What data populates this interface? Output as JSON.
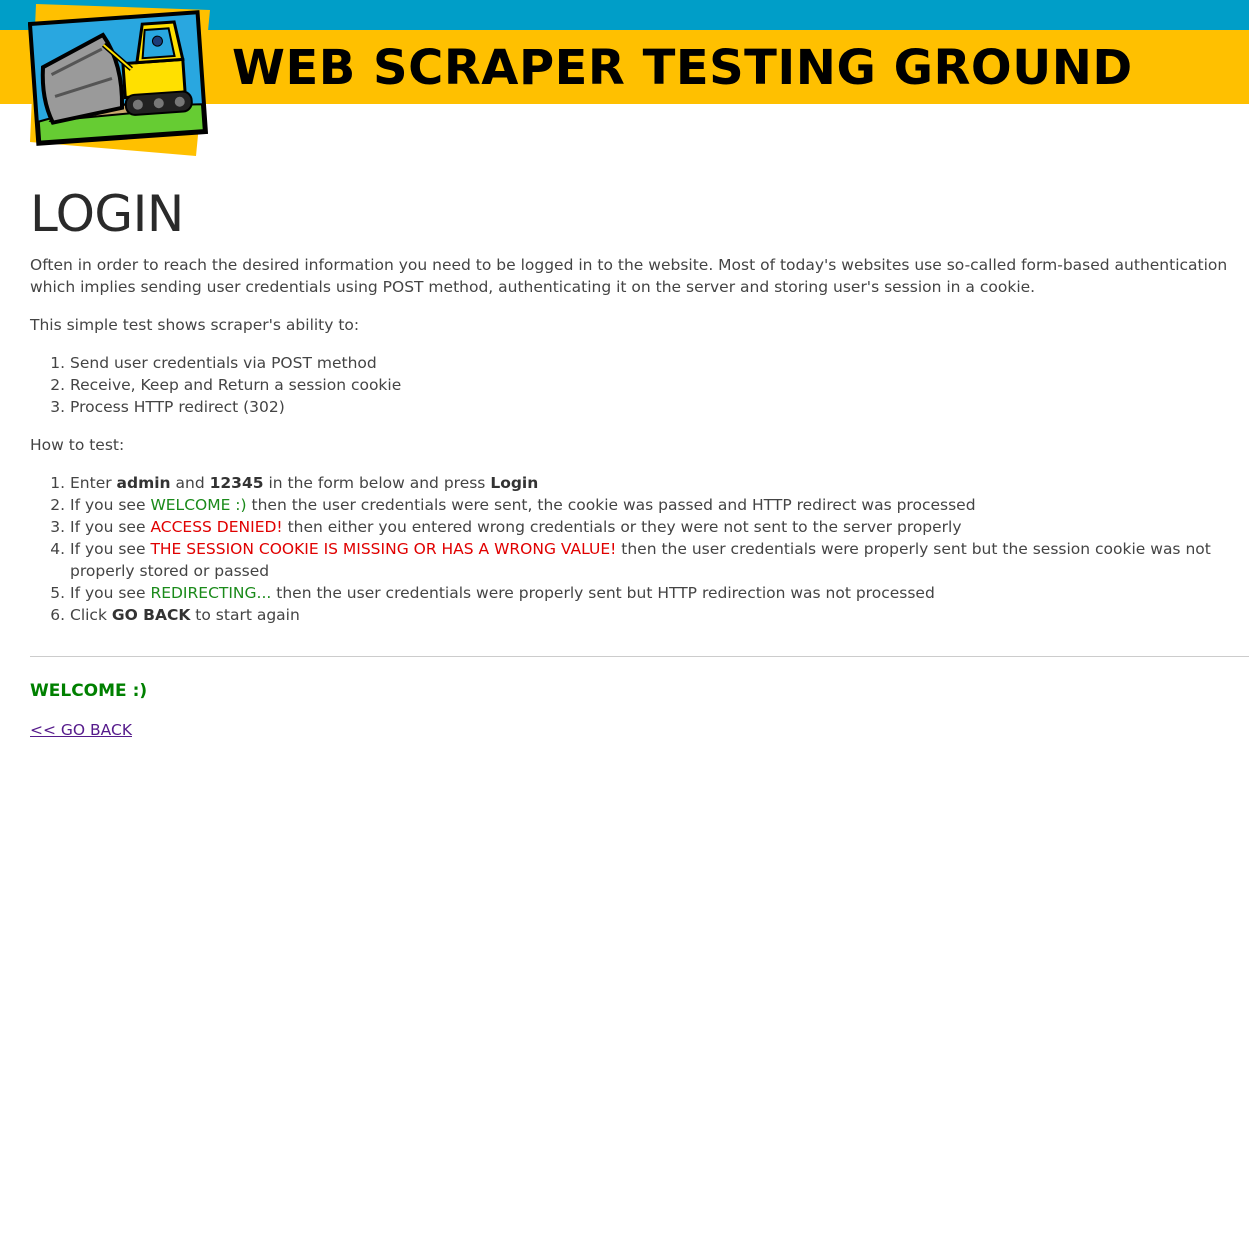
{
  "header": {
    "site_title": "WEB SCRAPER TESTING GROUND",
    "colors": {
      "top_bar": "#009ec8",
      "title_band": "#ffc000"
    },
    "logo_icon": "bulldozer-icon"
  },
  "main": {
    "heading": "LOGIN",
    "intro": "Often in order to reach the desired information you need to be logged in to the website. Most of today's websites use so-called form-based authentication which implies sending user credentials using POST method, authenticating it on the server and storing user's session in a cookie.",
    "abilities_lead": "This simple test shows scraper's ability to:",
    "abilities": [
      "Send user credentials via POST method",
      "Receive, Keep and Return a session cookie",
      "Process HTTP redirect (302)"
    ],
    "how_to_lead": "How to test:",
    "steps": {
      "s1": {
        "a": "Enter ",
        "b1": "admin",
        "c": " and ",
        "b2": "12345",
        "d": " in the form below and press ",
        "b3": "Login"
      },
      "s2": {
        "a": "If you see ",
        "hl": "WELCOME :)",
        "b": " then the user credentials were sent, the cookie was passed and HTTP redirect was processed"
      },
      "s3": {
        "a": "If you see ",
        "hl": "ACCESS DENIED!",
        "b": " then either you entered wrong credentials or they were not sent to the server properly"
      },
      "s4": {
        "a": "If you see ",
        "hl": "THE SESSION COOKIE IS MISSING OR HAS A WRONG VALUE!",
        "b": " then the user credentials were properly sent but the session cookie was not properly stored or passed"
      },
      "s5": {
        "a": "If you see ",
        "hl": "REDIRECTING...",
        "b": " then the user credentials were properly sent but HTTP redirection was not processed"
      },
      "s6": {
        "a": "Click ",
        "b1": "GO BACK",
        "c": " to start again"
      }
    },
    "result_message": "WELCOME :)",
    "go_back_link": "<< GO BACK",
    "colors": {
      "success": "#008000",
      "error": "#e00000",
      "link": "#551a8b"
    }
  }
}
